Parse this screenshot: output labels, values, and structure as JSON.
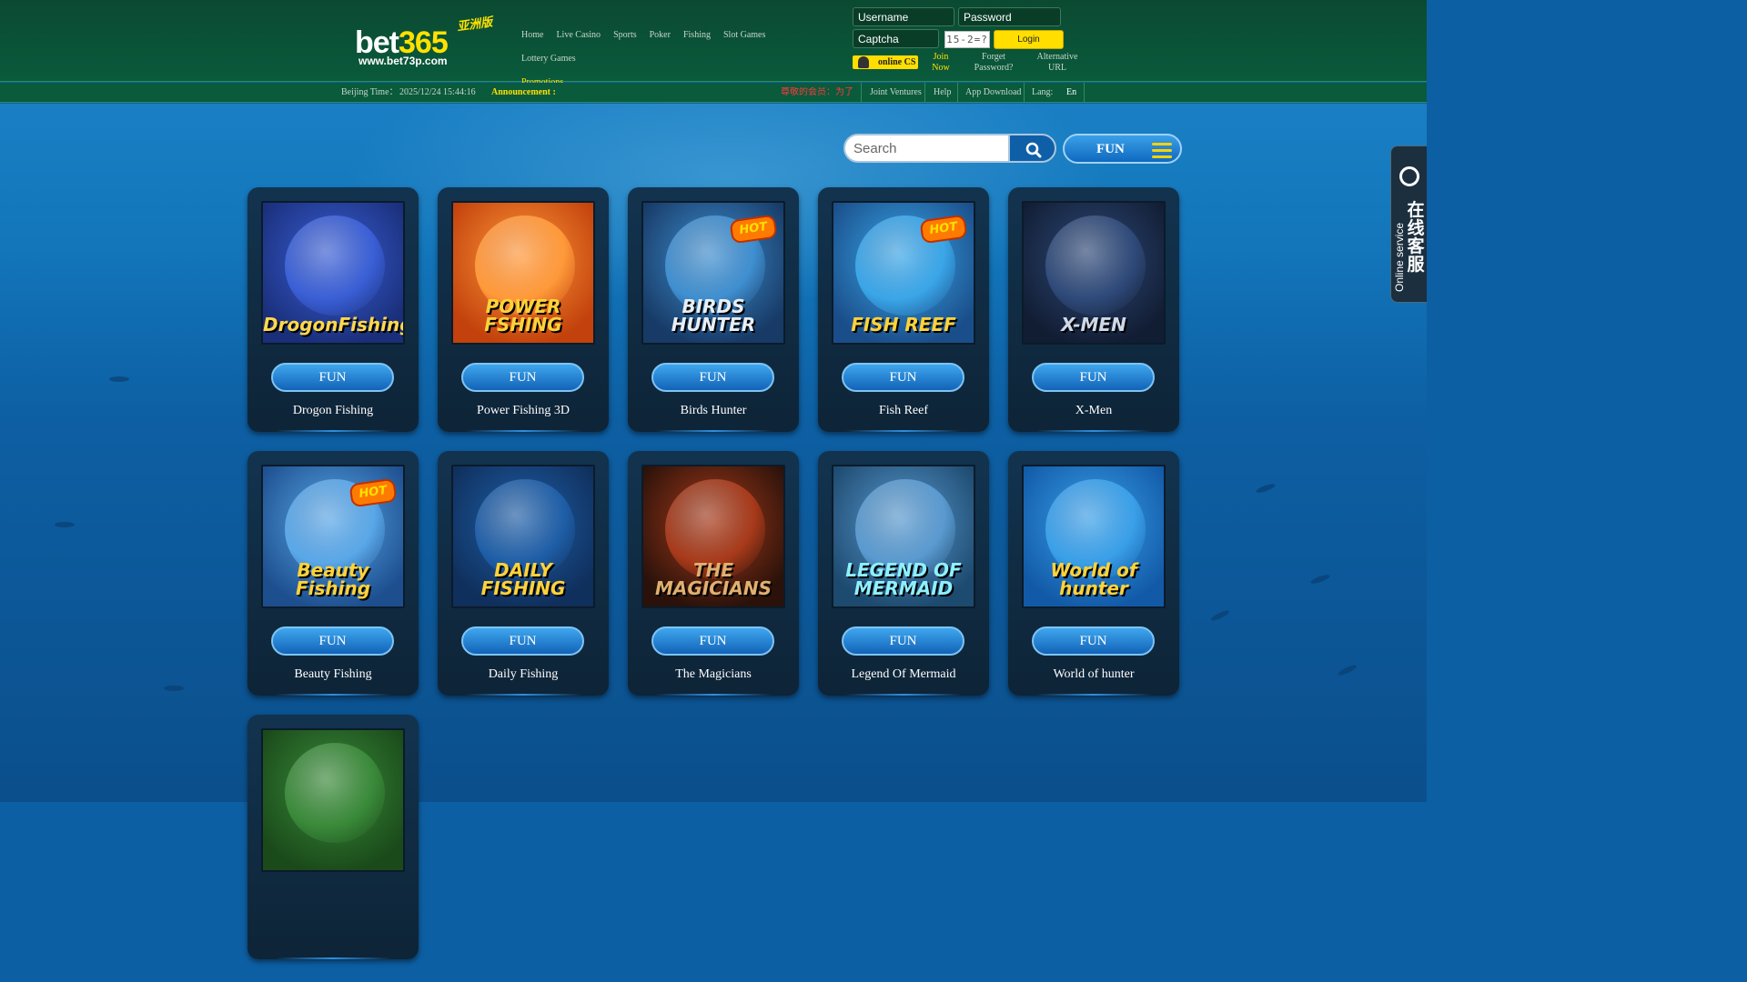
{
  "header": {
    "logo_text": "bet365",
    "logo_sub": "www.bet73p.com",
    "logo_cn": "亚洲版",
    "nav": [
      "Home",
      "Live Casino",
      "Sports",
      "Poker",
      "Fishing",
      "Slot Games",
      "Lottery Games",
      "Promotions"
    ],
    "login": {
      "username_placeholder": "Username",
      "password_placeholder": "Password",
      "captcha_placeholder": "Captcha",
      "captcha_text": "15-2=?",
      "login_label": "Login",
      "online_cs_label": "online CS",
      "join_now": "Join Now",
      "forget_password": "Forget Password?",
      "alternative_url": "Alternative URL"
    }
  },
  "infobar": {
    "beijing_time_label": "Beijing Time：",
    "beijing_time_value": "2025/12/24 15:44:16",
    "announcement_label": "Announcement :",
    "marquee_text": "尊敬的会员：为了",
    "links": [
      "Joint Ventures",
      "Help",
      "App Download"
    ],
    "lang_label": "Lang:",
    "lang_value": "En"
  },
  "toolbar": {
    "search_placeholder": "Search",
    "mode_label": "FUN"
  },
  "side_tab": {
    "en_label": "Online service",
    "cn_label": "在线客服"
  },
  "games": [
    {
      "name": "Drogon Fishing",
      "button": "FUN",
      "art": "DrogonFishing",
      "hot": false,
      "bg": [
        "#3a5fd6",
        "#1a2f7a"
      ],
      "art_color": "#ffd84a"
    },
    {
      "name": "Power Fishing 3D",
      "button": "FUN",
      "art": "POWER FSHING",
      "hot": false,
      "bg": [
        "#ff9a3a",
        "#c2410c"
      ],
      "art_color": "#ffd23a"
    },
    {
      "name": "Birds Hunter",
      "button": "FUN",
      "art": "BIRDS HUNTER",
      "hot": true,
      "bg": [
        "#3f8fd0",
        "#173a66"
      ],
      "art_color": "#e8eef5"
    },
    {
      "name": "Fish Reef",
      "button": "FUN",
      "art": "FISH REEF",
      "hot": true,
      "bg": [
        "#3aa6e8",
        "#1a4e8a"
      ],
      "art_color": "#ffd23a"
    },
    {
      "name": "X-Men",
      "button": "FUN",
      "art": "X-MEN",
      "hot": false,
      "bg": [
        "#2f4a7a",
        "#111d33"
      ],
      "art_color": "#cfd8e6"
    },
    {
      "name": "Beauty Fishing",
      "button": "FUN",
      "art": "Beauty Fishing",
      "hot": true,
      "bg": [
        "#5aa8e8",
        "#1d4f8f"
      ],
      "art_color": "#ffd23a"
    },
    {
      "name": "Daily Fishing",
      "button": "FUN",
      "art": "DAILY FISHING",
      "hot": false,
      "bg": [
        "#1f5fa8",
        "#0f2f5c"
      ],
      "art_color": "#ffd23a"
    },
    {
      "name": "The Magicians",
      "button": "FUN",
      "art": "THE MAGICIANS",
      "hot": false,
      "bg": [
        "#a83a1a",
        "#2a120a"
      ],
      "art_color": "#e0b070"
    },
    {
      "name": "Legend Of Mermaid",
      "button": "FUN",
      "art": "LEGEND OF MERMAID",
      "hot": false,
      "bg": [
        "#5a9ad0",
        "#1d4a6f"
      ],
      "art_color": "#8ef0ff"
    },
    {
      "name": "World of hunter",
      "button": "FUN",
      "art": "World of hunter",
      "hot": false,
      "bg": [
        "#3aa0e8",
        "#125aa8"
      ],
      "art_color": "#ffd23a"
    },
    {
      "name": "",
      "button": "",
      "art": "",
      "hot": false,
      "bg": [
        "#3a8a3a",
        "#1a4a1a"
      ],
      "art_color": "#ffd23a"
    }
  ],
  "colors": {
    "header_bg": "#0a5a3c",
    "accent_yellow": "#ffde00",
    "fun_blue": "#1a78cc",
    "card_bg": "#12334f"
  },
  "icons": [
    "search-icon",
    "menu-icon",
    "customer-service-icon",
    "hot-badge-icon"
  ]
}
